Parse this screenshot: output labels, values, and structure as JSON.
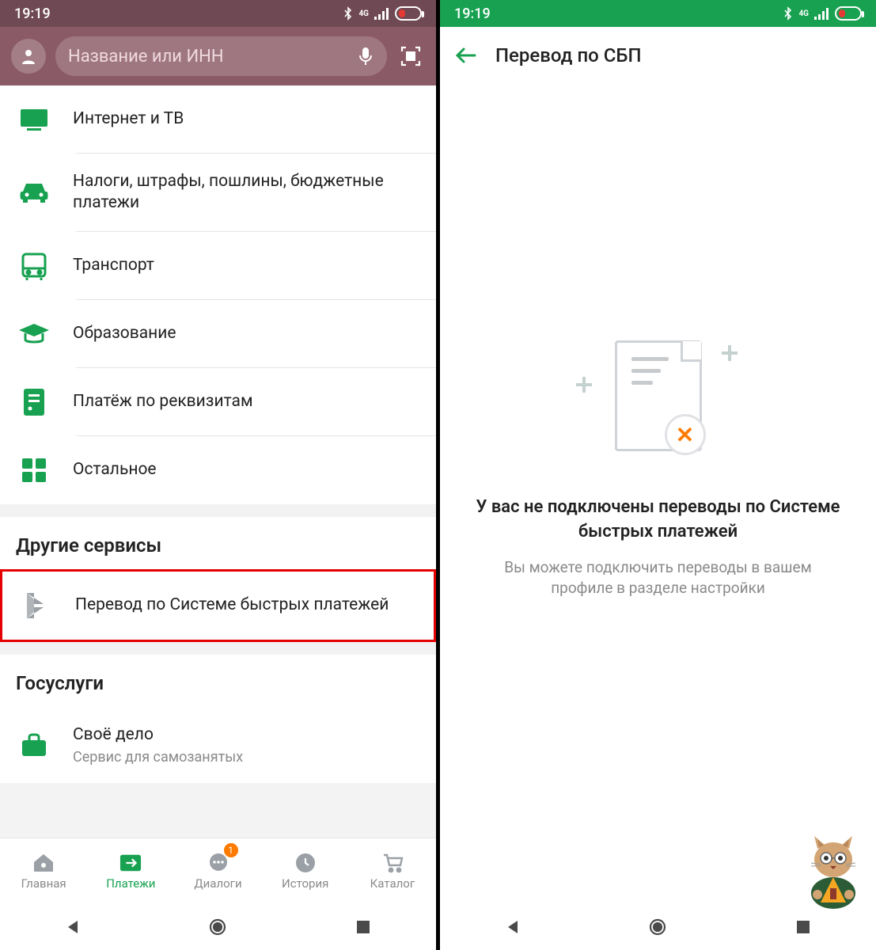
{
  "status": {
    "time": "19:19",
    "network_label": "4G"
  },
  "left": {
    "search_placeholder": "Название или ИНН",
    "categories": [
      {
        "icon": "tv",
        "label": "Интернет и ТВ"
      },
      {
        "icon": "car",
        "label": "Налоги, штрафы, пошлины, бюджетные платежи"
      },
      {
        "icon": "bus",
        "label": "Транспорт"
      },
      {
        "icon": "cap",
        "label": "Образование"
      },
      {
        "icon": "receipt",
        "label": "Платёж по реквизитам"
      },
      {
        "icon": "grid",
        "label": "Остальное"
      }
    ],
    "other_services_title": "Другие сервисы",
    "sbp_label": "Перевод по Системе быстрых платежей",
    "gosuslugi_title": "Госуслуги",
    "own_biz": {
      "label": "Своё дело",
      "sub": "Сервис для самозанятых"
    },
    "nav": {
      "home": "Главная",
      "payments": "Платежи",
      "dialogs": "Диалоги",
      "history": "История",
      "catalog": "Каталог",
      "badge": "1"
    }
  },
  "right": {
    "title": "Перевод по СБП",
    "empty_title": "У вас не подключены переводы по Системе быстрых платежей",
    "empty_sub": "Вы можете подключить переводы в вашем профиле в разделе настройки"
  }
}
